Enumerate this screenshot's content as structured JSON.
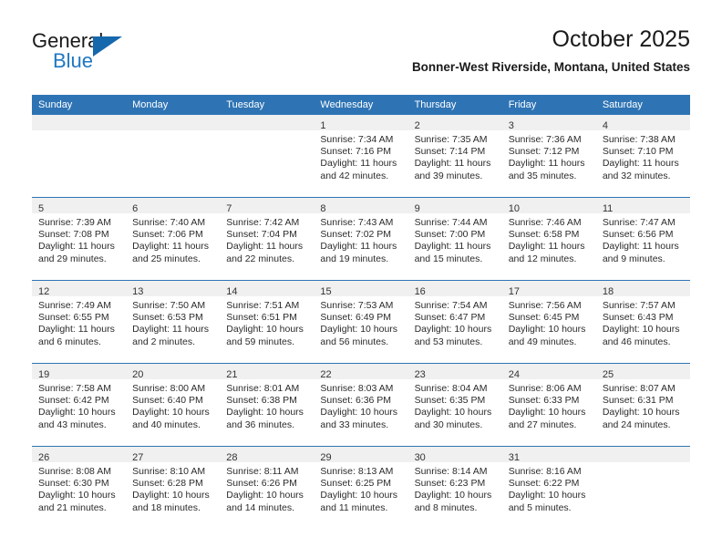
{
  "brand": {
    "name_part1": "General",
    "name_part2": "Blue",
    "triangle_color": "#1668ad",
    "blue_color": "#1f77c2"
  },
  "header": {
    "title": "October 2025",
    "subtitle": "Bonner-West Riverside, Montana, United States",
    "header_bg_color": "#2e74b5"
  },
  "calendar": {
    "weekday_headers": [
      "Sunday",
      "Monday",
      "Tuesday",
      "Wednesday",
      "Thursday",
      "Friday",
      "Saturday"
    ],
    "weeks": [
      [
        {
          "day": "",
          "sunrise": "",
          "sunset": "",
          "daylight_line1": "",
          "daylight_line2": ""
        },
        {
          "day": "",
          "sunrise": "",
          "sunset": "",
          "daylight_line1": "",
          "daylight_line2": ""
        },
        {
          "day": "",
          "sunrise": "",
          "sunset": "",
          "daylight_line1": "",
          "daylight_line2": ""
        },
        {
          "day": "1",
          "sunrise": "Sunrise: 7:34 AM",
          "sunset": "Sunset: 7:16 PM",
          "daylight_line1": "Daylight: 11 hours",
          "daylight_line2": "and 42 minutes."
        },
        {
          "day": "2",
          "sunrise": "Sunrise: 7:35 AM",
          "sunset": "Sunset: 7:14 PM",
          "daylight_line1": "Daylight: 11 hours",
          "daylight_line2": "and 39 minutes."
        },
        {
          "day": "3",
          "sunrise": "Sunrise: 7:36 AM",
          "sunset": "Sunset: 7:12 PM",
          "daylight_line1": "Daylight: 11 hours",
          "daylight_line2": "and 35 minutes."
        },
        {
          "day": "4",
          "sunrise": "Sunrise: 7:38 AM",
          "sunset": "Sunset: 7:10 PM",
          "daylight_line1": "Daylight: 11 hours",
          "daylight_line2": "and 32 minutes."
        }
      ],
      [
        {
          "day": "5",
          "sunrise": "Sunrise: 7:39 AM",
          "sunset": "Sunset: 7:08 PM",
          "daylight_line1": "Daylight: 11 hours",
          "daylight_line2": "and 29 minutes."
        },
        {
          "day": "6",
          "sunrise": "Sunrise: 7:40 AM",
          "sunset": "Sunset: 7:06 PM",
          "daylight_line1": "Daylight: 11 hours",
          "daylight_line2": "and 25 minutes."
        },
        {
          "day": "7",
          "sunrise": "Sunrise: 7:42 AM",
          "sunset": "Sunset: 7:04 PM",
          "daylight_line1": "Daylight: 11 hours",
          "daylight_line2": "and 22 minutes."
        },
        {
          "day": "8",
          "sunrise": "Sunrise: 7:43 AM",
          "sunset": "Sunset: 7:02 PM",
          "daylight_line1": "Daylight: 11 hours",
          "daylight_line2": "and 19 minutes."
        },
        {
          "day": "9",
          "sunrise": "Sunrise: 7:44 AM",
          "sunset": "Sunset: 7:00 PM",
          "daylight_line1": "Daylight: 11 hours",
          "daylight_line2": "and 15 minutes."
        },
        {
          "day": "10",
          "sunrise": "Sunrise: 7:46 AM",
          "sunset": "Sunset: 6:58 PM",
          "daylight_line1": "Daylight: 11 hours",
          "daylight_line2": "and 12 minutes."
        },
        {
          "day": "11",
          "sunrise": "Sunrise: 7:47 AM",
          "sunset": "Sunset: 6:56 PM",
          "daylight_line1": "Daylight: 11 hours",
          "daylight_line2": "and 9 minutes."
        }
      ],
      [
        {
          "day": "12",
          "sunrise": "Sunrise: 7:49 AM",
          "sunset": "Sunset: 6:55 PM",
          "daylight_line1": "Daylight: 11 hours",
          "daylight_line2": "and 6 minutes."
        },
        {
          "day": "13",
          "sunrise": "Sunrise: 7:50 AM",
          "sunset": "Sunset: 6:53 PM",
          "daylight_line1": "Daylight: 11 hours",
          "daylight_line2": "and 2 minutes."
        },
        {
          "day": "14",
          "sunrise": "Sunrise: 7:51 AM",
          "sunset": "Sunset: 6:51 PM",
          "daylight_line1": "Daylight: 10 hours",
          "daylight_line2": "and 59 minutes."
        },
        {
          "day": "15",
          "sunrise": "Sunrise: 7:53 AM",
          "sunset": "Sunset: 6:49 PM",
          "daylight_line1": "Daylight: 10 hours",
          "daylight_line2": "and 56 minutes."
        },
        {
          "day": "16",
          "sunrise": "Sunrise: 7:54 AM",
          "sunset": "Sunset: 6:47 PM",
          "daylight_line1": "Daylight: 10 hours",
          "daylight_line2": "and 53 minutes."
        },
        {
          "day": "17",
          "sunrise": "Sunrise: 7:56 AM",
          "sunset": "Sunset: 6:45 PM",
          "daylight_line1": "Daylight: 10 hours",
          "daylight_line2": "and 49 minutes."
        },
        {
          "day": "18",
          "sunrise": "Sunrise: 7:57 AM",
          "sunset": "Sunset: 6:43 PM",
          "daylight_line1": "Daylight: 10 hours",
          "daylight_line2": "and 46 minutes."
        }
      ],
      [
        {
          "day": "19",
          "sunrise": "Sunrise: 7:58 AM",
          "sunset": "Sunset: 6:42 PM",
          "daylight_line1": "Daylight: 10 hours",
          "daylight_line2": "and 43 minutes."
        },
        {
          "day": "20",
          "sunrise": "Sunrise: 8:00 AM",
          "sunset": "Sunset: 6:40 PM",
          "daylight_line1": "Daylight: 10 hours",
          "daylight_line2": "and 40 minutes."
        },
        {
          "day": "21",
          "sunrise": "Sunrise: 8:01 AM",
          "sunset": "Sunset: 6:38 PM",
          "daylight_line1": "Daylight: 10 hours",
          "daylight_line2": "and 36 minutes."
        },
        {
          "day": "22",
          "sunrise": "Sunrise: 8:03 AM",
          "sunset": "Sunset: 6:36 PM",
          "daylight_line1": "Daylight: 10 hours",
          "daylight_line2": "and 33 minutes."
        },
        {
          "day": "23",
          "sunrise": "Sunrise: 8:04 AM",
          "sunset": "Sunset: 6:35 PM",
          "daylight_line1": "Daylight: 10 hours",
          "daylight_line2": "and 30 minutes."
        },
        {
          "day": "24",
          "sunrise": "Sunrise: 8:06 AM",
          "sunset": "Sunset: 6:33 PM",
          "daylight_line1": "Daylight: 10 hours",
          "daylight_line2": "and 27 minutes."
        },
        {
          "day": "25",
          "sunrise": "Sunrise: 8:07 AM",
          "sunset": "Sunset: 6:31 PM",
          "daylight_line1": "Daylight: 10 hours",
          "daylight_line2": "and 24 minutes."
        }
      ],
      [
        {
          "day": "26",
          "sunrise": "Sunrise: 8:08 AM",
          "sunset": "Sunset: 6:30 PM",
          "daylight_line1": "Daylight: 10 hours",
          "daylight_line2": "and 21 minutes."
        },
        {
          "day": "27",
          "sunrise": "Sunrise: 8:10 AM",
          "sunset": "Sunset: 6:28 PM",
          "daylight_line1": "Daylight: 10 hours",
          "daylight_line2": "and 18 minutes."
        },
        {
          "day": "28",
          "sunrise": "Sunrise: 8:11 AM",
          "sunset": "Sunset: 6:26 PM",
          "daylight_line1": "Daylight: 10 hours",
          "daylight_line2": "and 14 minutes."
        },
        {
          "day": "29",
          "sunrise": "Sunrise: 8:13 AM",
          "sunset": "Sunset: 6:25 PM",
          "daylight_line1": "Daylight: 10 hours",
          "daylight_line2": "and 11 minutes."
        },
        {
          "day": "30",
          "sunrise": "Sunrise: 8:14 AM",
          "sunset": "Sunset: 6:23 PM",
          "daylight_line1": "Daylight: 10 hours",
          "daylight_line2": "and 8 minutes."
        },
        {
          "day": "31",
          "sunrise": "Sunrise: 8:16 AM",
          "sunset": "Sunset: 6:22 PM",
          "daylight_line1": "Daylight: 10 hours",
          "daylight_line2": "and 5 minutes."
        },
        {
          "day": "",
          "sunrise": "",
          "sunset": "",
          "daylight_line1": "",
          "daylight_line2": ""
        }
      ]
    ]
  }
}
